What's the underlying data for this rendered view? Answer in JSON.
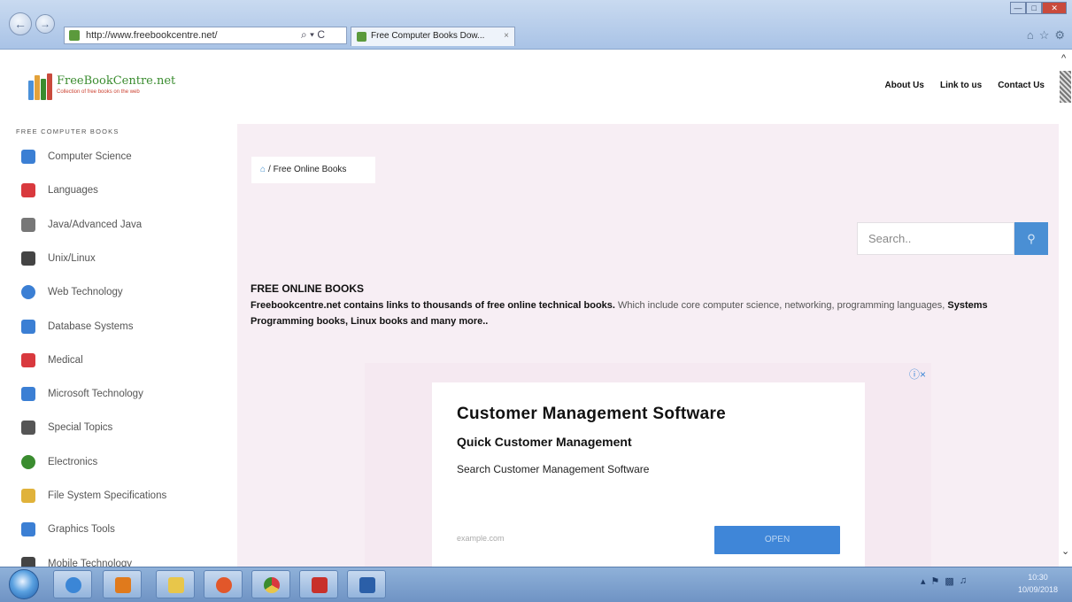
{
  "browser": {
    "url": "http://www.freebookcentre.net/",
    "address_tools": "⌕ ▾ C",
    "tab_title": "Free Computer Books Dow...",
    "tab_close": "×"
  },
  "site": {
    "logo_text": "FreeBookCentre.net",
    "logo_tagline": "Collection of free books on the web",
    "nav": [
      "About Us",
      "Link to us",
      "Contact Us"
    ]
  },
  "sidebar": {
    "title": "FREE COMPUTER BOOKS",
    "items": [
      {
        "label": "Computer Science",
        "icon": "monitor-icon",
        "color": "#3b7fd4"
      },
      {
        "label": "Languages",
        "icon": "code-icon",
        "color": "#d9393e"
      },
      {
        "label": "Java/Advanced Java",
        "icon": "java-cup-icon",
        "color": "#777777"
      },
      {
        "label": "Unix/Linux",
        "icon": "linux-penguin-icon",
        "color": "#444444"
      },
      {
        "label": "Web Technology",
        "icon": "globe-icon",
        "color": "#3b7fd4"
      },
      {
        "label": "Database Systems",
        "icon": "database-icon",
        "color": "#3b7fd4"
      },
      {
        "label": "Medical",
        "icon": "heart-icon",
        "color": "#d9393e"
      },
      {
        "label": "Microsoft Technology",
        "icon": "windows-icon",
        "color": "#3b7fd4"
      },
      {
        "label": "Special Topics",
        "icon": "magic-wand-icon",
        "color": "#555555"
      },
      {
        "label": "Electronics",
        "icon": "chip-icon",
        "color": "#3a8c2f"
      },
      {
        "label": "File System Specifications",
        "icon": "folder-icon",
        "color": "#e0b23a"
      },
      {
        "label": "Graphics Tools",
        "icon": "pen-icon",
        "color": "#3b7fd4"
      },
      {
        "label": "Mobile Technology",
        "icon": "mobile-icon",
        "color": "#444444"
      }
    ]
  },
  "breadcrumb": {
    "label": "Free Online Books"
  },
  "search": {
    "placeholder": "Search.."
  },
  "intro": {
    "heading": "FREE ONLINE BOOKS",
    "text_bold": "Freebookcentre.net contains links to thousands of free online technical books.",
    "text_light": "Which include core computer science, networking, programming languages,",
    "text_bold_2": "Systems Programming books, Linux books and many more.."
  },
  "ad": {
    "badge": "ⓘ×",
    "title": "Customer Management Software",
    "subtitle": "Quick Customer Management",
    "description": "Search Customer Management Software",
    "domain": "example.com",
    "button": "OPEN"
  },
  "taskbar": {
    "clock_time": "10:30",
    "clock_date": "10/09/2018"
  }
}
